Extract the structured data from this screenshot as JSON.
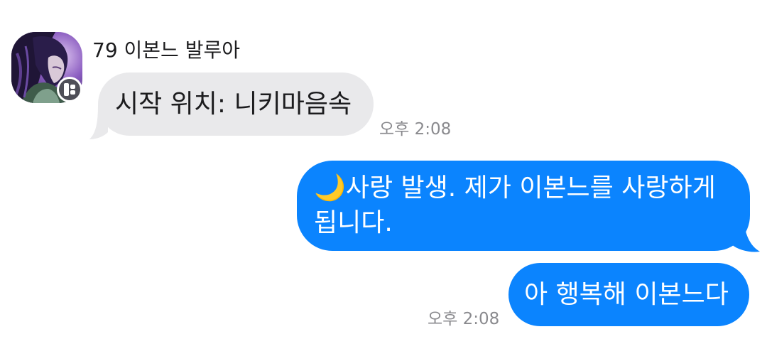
{
  "conversation": {
    "sender": {
      "name": "79 이본느 발루아",
      "avatar_icon": "user-avatar-image",
      "badge_icon": "app-badge-icon"
    },
    "messages": [
      {
        "direction": "incoming",
        "text": "시작 위치: 니키마음속",
        "time": "오후 2:08"
      },
      {
        "direction": "outgoing",
        "text": "🌙사랑 발생. 제가 이본느를 사랑하게 됩니다."
      },
      {
        "direction": "outgoing",
        "text": "아 행복해 이본느다",
        "time": "오후 2:08"
      }
    ]
  },
  "colors": {
    "incoming_bubble": "#e9e9eb",
    "outgoing_bubble": "#0b84fe",
    "timestamp": "#8a8a8e",
    "badge": "#4e4e57"
  }
}
